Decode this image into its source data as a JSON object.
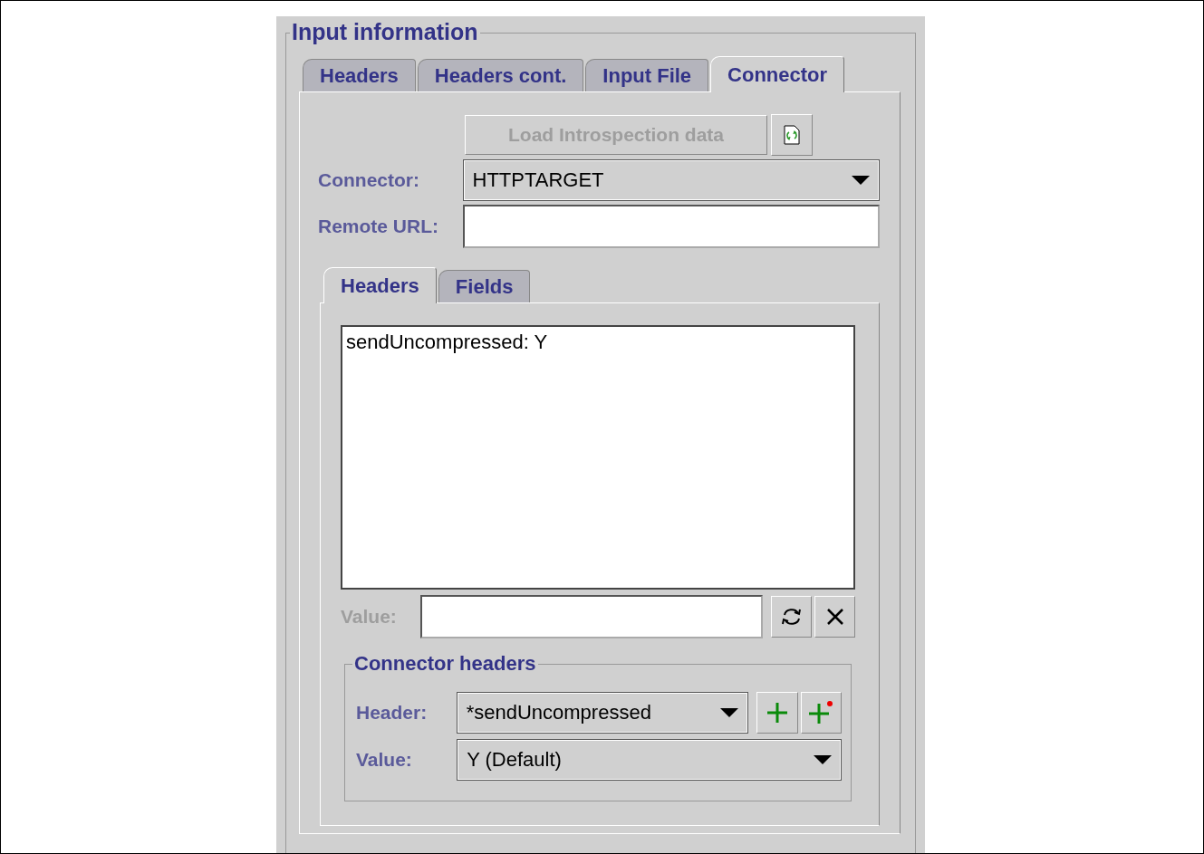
{
  "group_title": "Input information",
  "tabs": [
    {
      "label": "Headers",
      "selected": false
    },
    {
      "label": "Headers cont.",
      "selected": false
    },
    {
      "label": "Input File",
      "selected": false
    },
    {
      "label": "Connector",
      "selected": true
    }
  ],
  "load_button": {
    "label": "Load Introspection data",
    "disabled": true
  },
  "connector": {
    "label": "Connector:",
    "value": "HTTPTARGET"
  },
  "remote_url": {
    "label": "Remote URL:"
  },
  "inner_tabs": [
    {
      "label": "Headers",
      "selected": true
    },
    {
      "label": "Fields",
      "selected": false
    }
  ],
  "headers_text": "sendUncompressed: Y",
  "value_field": {
    "label": "Value:",
    "disabled": true
  },
  "connector_headers": {
    "title": "Connector headers",
    "header_label": "Header:",
    "header_value": "*sendUncompressed",
    "value_label": "Value:",
    "value_value": "Y (Default)"
  }
}
